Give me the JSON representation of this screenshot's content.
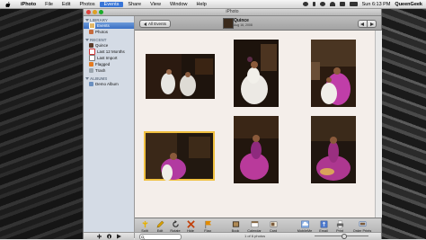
{
  "menubar": {
    "app": "iPhoto",
    "items": [
      "File",
      "Edit",
      "Photos",
      "Events",
      "Share",
      "View",
      "Window",
      "Help"
    ],
    "active": "Events",
    "clock": "Sun 6:13 PM",
    "user": "QueenGeek"
  },
  "window": {
    "title": "iPhoto"
  },
  "sidebar": {
    "library_header": "LIBRARY",
    "library": [
      {
        "label": "Events",
        "selected": true
      },
      {
        "label": "Photos",
        "selected": false
      }
    ],
    "recent_header": "RECENT",
    "recent": [
      "Quince",
      "Last 12 Months",
      "Last Import",
      "Flagged",
      "Trash"
    ],
    "albums_header": "ALBUMS",
    "albums": [
      "Demo Album"
    ]
  },
  "topbar": {
    "back_button": "All Events",
    "event_title": "Quince",
    "event_date": "Aug 16, 2008"
  },
  "photos_count_label": "1 of 6 photos",
  "toolbar": {
    "left": [
      {
        "label": "Split",
        "icon": "split-icon",
        "color": "#e7b100"
      },
      {
        "label": "Edit",
        "icon": "pencil-icon",
        "color": "#d8a000"
      },
      {
        "label": "Rotate",
        "icon": "rotate-icon",
        "color": "#333333"
      },
      {
        "label": "Hide",
        "icon": "hide-x-icon",
        "color": "#c2410c"
      },
      {
        "label": "Flag",
        "icon": "flag-icon",
        "color": "#e08a00"
      }
    ],
    "middle": [
      {
        "label": "Book",
        "icon": "book-icon"
      },
      {
        "label": "Calendar",
        "icon": "calendar-icon"
      },
      {
        "label": "Card",
        "icon": "card-icon"
      }
    ],
    "right": [
      {
        "label": "MobileMe",
        "icon": "mobileme-icon"
      },
      {
        "label": "Email",
        "icon": "email-icon"
      },
      {
        "label": "Print",
        "icon": "print-icon"
      },
      {
        "label": "Order Prints",
        "icon": "order-prints-icon"
      }
    ]
  },
  "colors": {
    "selection": "#f0c040",
    "sidebar_bg": "#d4dbe5",
    "content_bg": "#f4eeea"
  }
}
